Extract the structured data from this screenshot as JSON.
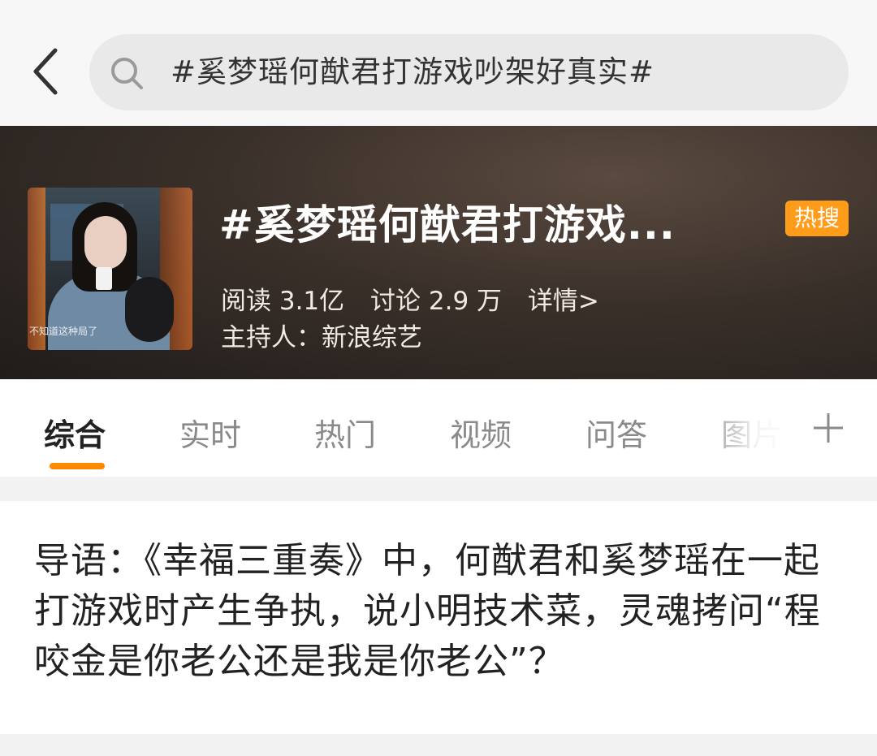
{
  "search": {
    "query": "#奚梦瑶何猷君打游戏吵架好真实#"
  },
  "topic": {
    "title": "#奚梦瑶何猷君打游戏...",
    "badge": "热搜",
    "reads": "阅读 3.1亿",
    "discussions": "讨论 2.9 万",
    "details": "详情>",
    "host": "主持人：新浪综艺",
    "thumbnail_caption": "不知道这种局了"
  },
  "tabs": [
    {
      "label": "综合",
      "active": true
    },
    {
      "label": "实时",
      "active": false
    },
    {
      "label": "热门",
      "active": false
    },
    {
      "label": "视频",
      "active": false
    },
    {
      "label": "问答",
      "active": false
    },
    {
      "label": "图片",
      "active": false
    }
  ],
  "intro": {
    "text": "导语：《幸福三重奏》中，何猷君和奚梦瑶在一起打游戏时产生争执，说小明技术菜，灵魂拷问“程咬金是你老公还是我是你老公”？"
  },
  "colors": {
    "accent": "#ff8a00",
    "badge": "#ff9c1a",
    "banner_dark": "#201c1a"
  },
  "icons": [
    "back-arrow-icon",
    "search-icon",
    "plus-icon"
  ]
}
